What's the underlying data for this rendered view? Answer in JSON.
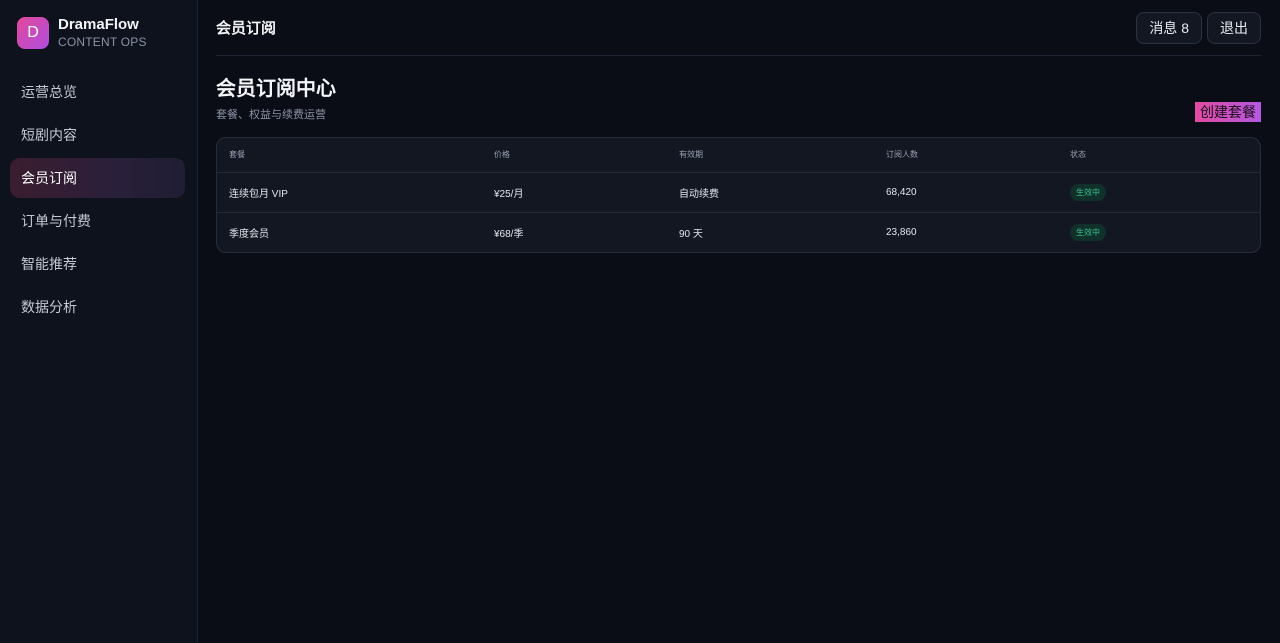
{
  "brand": {
    "logo_letter": "D",
    "name": "DramaFlow",
    "subtitle": "CONTENT OPS"
  },
  "sidebar": {
    "items": [
      {
        "label": "运营总览",
        "active": false
      },
      {
        "label": "短剧内容",
        "active": false
      },
      {
        "label": "会员订阅",
        "active": true
      },
      {
        "label": "订单与付费",
        "active": false
      },
      {
        "label": "智能推荐",
        "active": false
      },
      {
        "label": "数据分析",
        "active": false
      }
    ]
  },
  "header": {
    "title": "会员订阅",
    "messages_label": "消息 8",
    "logout_label": "退出"
  },
  "page": {
    "title": "会员订阅中心",
    "subtitle": "套餐、权益与续费运营",
    "create_label": "创建套餐"
  },
  "table": {
    "headers": [
      "套餐",
      "价格",
      "有效期",
      "订阅人数",
      "状态"
    ],
    "rows": [
      {
        "plan": "连续包月 VIP",
        "price": "¥25/月",
        "validity": "自动续费",
        "subscribers": "68,420",
        "status": "生效中"
      },
      {
        "plan": "季度会员",
        "price": "¥68/季",
        "validity": "90 天",
        "subscribers": "23,860",
        "status": "生效中"
      }
    ]
  },
  "colors": {
    "accent_start": "#e2489a",
    "accent_end": "#b04ee0",
    "status_active": "#38c28c",
    "background": "#0a0d15"
  }
}
